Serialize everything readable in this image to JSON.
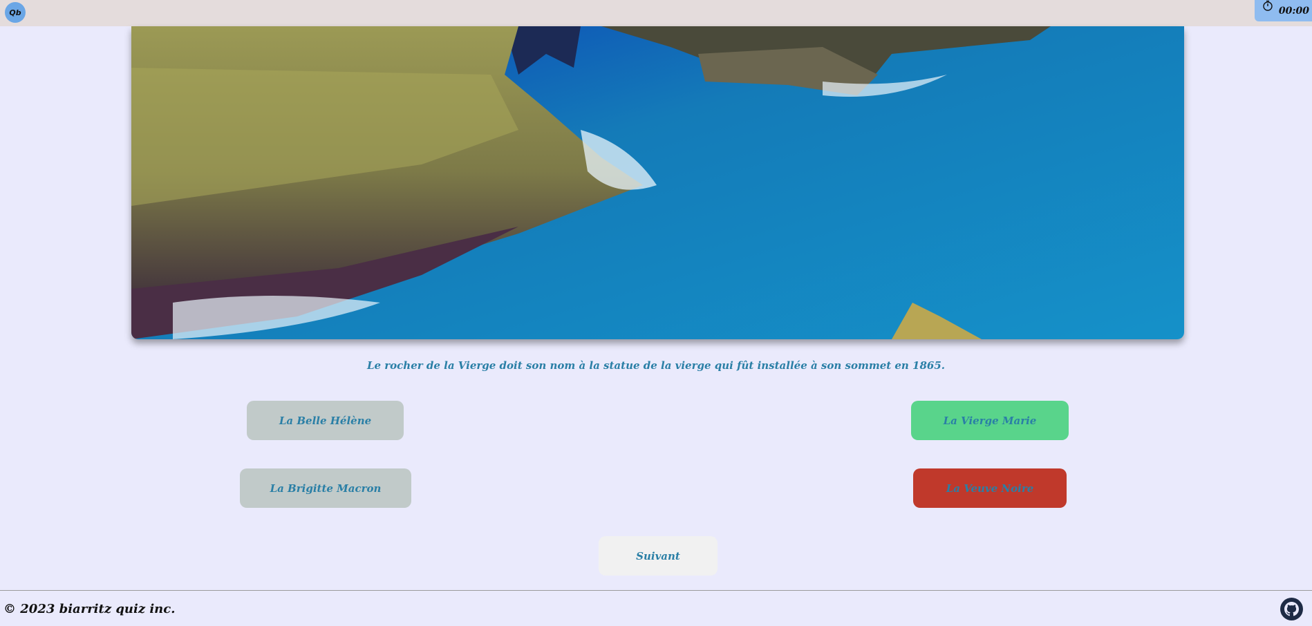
{
  "header": {
    "logo_text": "Qb",
    "timer": "00:00",
    "timer_icon": "stopwatch-icon"
  },
  "hero": {
    "image": "rocky-coast-photo"
  },
  "question": {
    "info_text": "Le rocher de la Vierge doit son nom à la statue de la vierge qui fût installée à son sommet en 1865.",
    "answers": [
      {
        "label": "La Belle Hélène",
        "state": "neutral",
        "color": "#c1cac9"
      },
      {
        "label": "La Vierge Marie",
        "state": "correct",
        "color": "#59d48b"
      },
      {
        "label": "La Brigitte Macron",
        "state": "neutral",
        "color": "#c1cac9"
      },
      {
        "label": "La Veuve Noire",
        "state": "wrong",
        "color": "#c0392b"
      }
    ],
    "next_label": "Suivant"
  },
  "footer": {
    "copyright": "© 2023 biarritz quiz inc.",
    "github_icon": "github-icon"
  },
  "colors": {
    "background": "#eaeafc",
    "text_accent": "#2a7fa6",
    "topbar": "#e4dcdc",
    "timer_bg": "#8fbcf0"
  }
}
